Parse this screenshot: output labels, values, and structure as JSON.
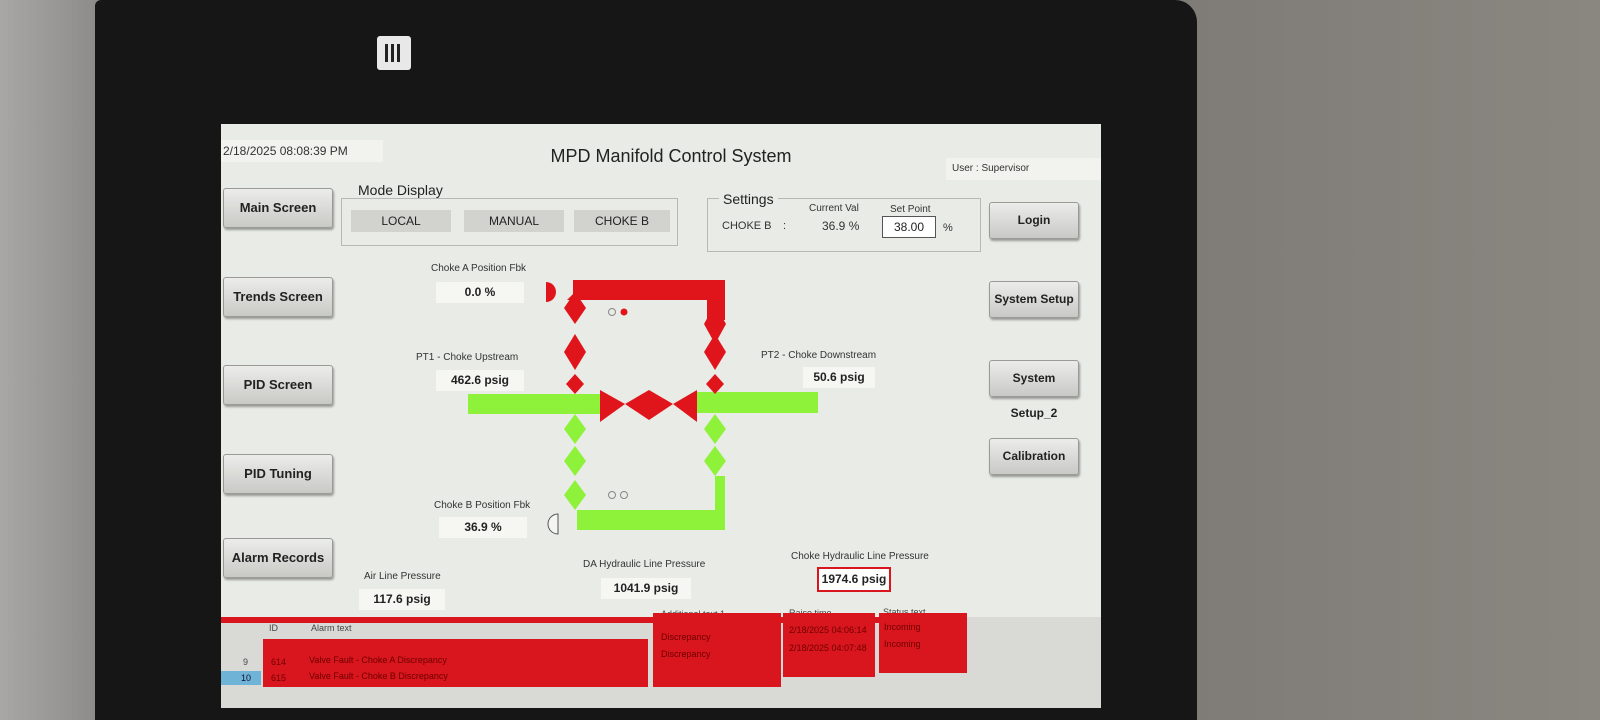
{
  "header": {
    "datetime": "2/18/2025 08:08:39 PM",
    "title": "MPD Manifold Control System",
    "user": "User : Supervisor"
  },
  "nav_left": [
    "Main Screen",
    "Trends Screen",
    "PID Screen",
    "PID Tuning",
    "Alarm Records"
  ],
  "nav_right": [
    "Login",
    "System Setup",
    "System Setup_2",
    "Calibration"
  ],
  "mode_display": {
    "legend": "Mode Display",
    "buttons": [
      "LOCAL",
      "MANUAL",
      "CHOKE B"
    ]
  },
  "settings": {
    "legend": "Settings",
    "col_current": "Current Val",
    "col_setpoint": "Set Point",
    "label": "CHOKE B",
    "separator": ":",
    "current_val": "36.9 %",
    "set_point": "38.00",
    "unit": "%"
  },
  "readings": {
    "choke_a_label": "Choke A Position Fbk",
    "choke_a_value": "0.0 %",
    "pt1_label": "PT1 - Choke Upstream",
    "pt1_value": "462.6 psig",
    "pt2_label": "PT2 - Choke Downstream",
    "pt2_value": "50.6 psig",
    "choke_b_label": "Choke B Position Fbk",
    "choke_b_value": "36.9 %",
    "air_label": "Air Line Pressure",
    "air_value": "117.6 psig",
    "da_label": "DA Hydraulic Line Pressure",
    "da_value": "1041.9 psig",
    "choke_hyd_label": "Choke Hydraulic Line Pressure",
    "choke_hyd_value": "1974.6 psig"
  },
  "alarm_table": {
    "headers": {
      "id": "ID",
      "alarm_text": "Alarm text",
      "additional": "Additional text 1",
      "raise_time": "Raise time",
      "status": "Status text"
    },
    "rows": [
      {
        "no": "9",
        "id": "614",
        "text": "Valve Fault - Choke A Discrepancy",
        "additional": "Discrepancy",
        "time": "2/18/2025 04:06:14",
        "status": "Incoming"
      },
      {
        "no": "10",
        "id": "615",
        "text": "Valve Fault - Choke B Discrepancy",
        "additional": "Discrepancy",
        "time": "2/18/2025 04:07:48",
        "status": "Incoming"
      }
    ]
  },
  "colors": {
    "valve_closed": "#e0151b",
    "flow_active": "#8ef23a",
    "alarm_red": "#d9151d"
  }
}
